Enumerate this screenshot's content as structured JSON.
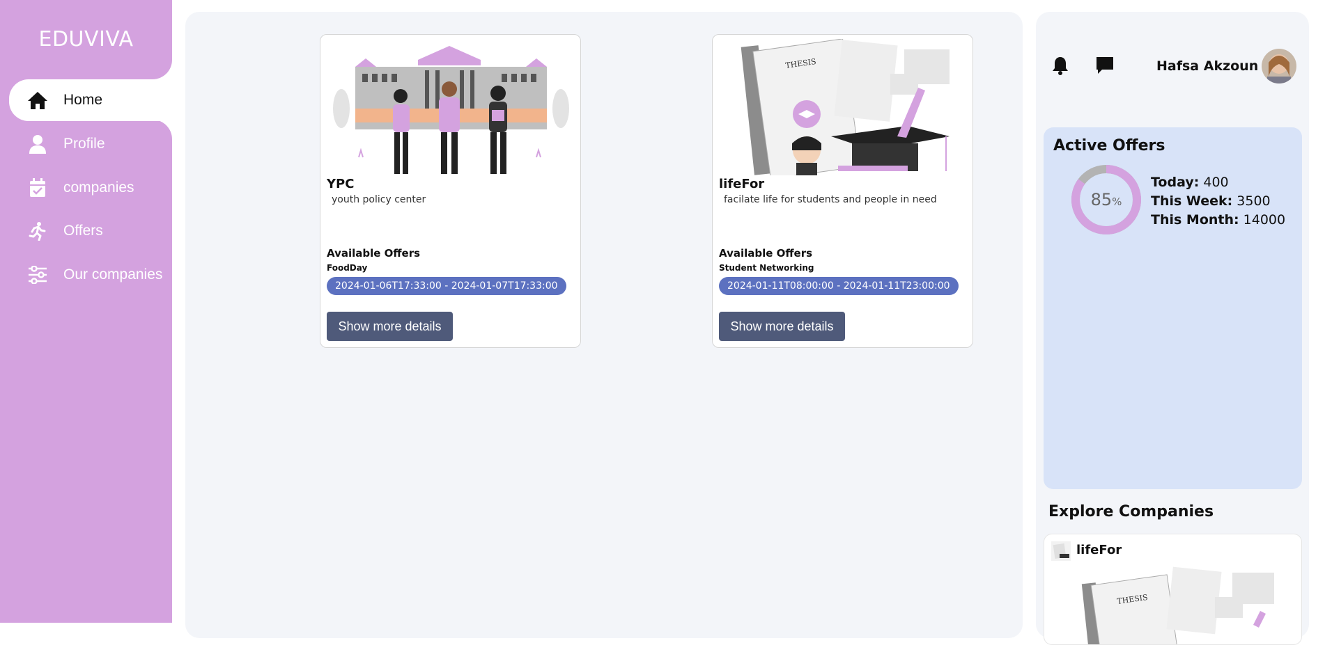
{
  "sidebar": {
    "logo": "EDUVIVA",
    "items": [
      {
        "label": "Home",
        "icon": "home-icon",
        "active": true
      },
      {
        "label": "Profile",
        "icon": "user-icon",
        "active": false
      },
      {
        "label": "companies",
        "icon": "calendar-check-icon",
        "active": false
      },
      {
        "label": "Offers",
        "icon": "running-person-icon",
        "active": false
      },
      {
        "label": "Our companies",
        "icon": "sliders-icon",
        "active": false
      }
    ]
  },
  "cards": [
    {
      "title": "YPC",
      "description": "youth policy center",
      "offers_heading": "Available Offers",
      "offer_name": "FoodDay",
      "date_range": "2024-01-06T17:33:00 - 2024-01-07T17:33:00",
      "button_label": "Show more details",
      "image": "university-students-illustration"
    },
    {
      "title": "lifeFor",
      "description": "facilate life for students and people in need",
      "offers_heading": "Available Offers",
      "offer_name": "Student Networking",
      "date_range": "2024-01-11T08:00:00 - 2024-01-11T23:00:00",
      "button_label": "Show more details",
      "image": "thesis-graduation-illustration"
    }
  ],
  "header": {
    "user_name": "Hafsa Akzoun",
    "icons": [
      "bell-icon",
      "chat-icon"
    ]
  },
  "active_offers": {
    "title": "Active Offers",
    "percent": "85",
    "percent_unit": "%",
    "percent_value": 0.85,
    "today_label": "Today:",
    "today_value": "400",
    "week_label": "This Week:",
    "week_value": "3500",
    "month_label": "This Month:",
    "month_value": "14000"
  },
  "explore": {
    "title": "Explore Companies",
    "company_name": "lifeFor"
  },
  "colors": {
    "sidebar": "#d4a2df",
    "accent": "#5c71c0",
    "button": "#4f5a7a",
    "panel": "#f3f5f9",
    "active_box": "#d8e3f8",
    "donut": "#d4a2df",
    "donut_track": "#b3b3b3"
  }
}
